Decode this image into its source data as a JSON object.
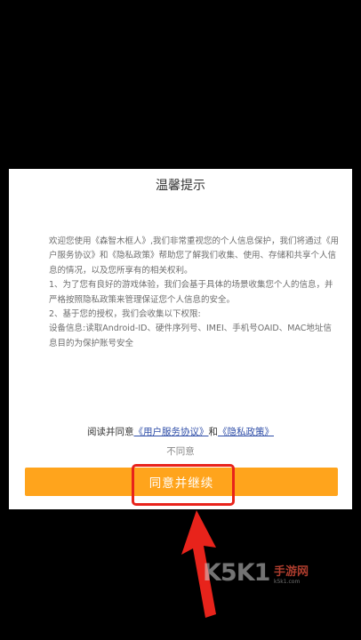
{
  "dialog": {
    "title": "温馨提示",
    "body": [
      "欢迎您使用《森智木框人》,我们非常重视您的个人信息保护，我们将通过《用户服务协议》和《隐私政策》帮助您了解我们收集、使用、存储和共享个人信息的情况，以及您所享有的相关权利。",
      "1、为了您有良好的游戏体验，我们会基于具体的场景收集您个人的信息，并严格按照隐私政策来管理保证您个人信息的安全。",
      "2、基于您的授权，我们会收集以下权限:",
      "设备信息:读取Android-ID、硬件序列号、IMEI、手机号OAID、MAC地址信息目的为保护账号安全"
    ],
    "consent": {
      "prefix": "阅读并同意",
      "terms_link": "《用户服务协议》",
      "conjunction": "和",
      "privacy_link": "《隐私政策》"
    },
    "disagree_label": "不同意",
    "agree_label": "同意并继续"
  },
  "watermark": {
    "logo": "K5K1",
    "cn": "手游网",
    "en": "k5k1.com"
  },
  "colors": {
    "background": "#000000",
    "dialog": "#ffffff",
    "button": "#ffa41c",
    "highlight": "#e8231b",
    "link": "#2f4ea8"
  }
}
